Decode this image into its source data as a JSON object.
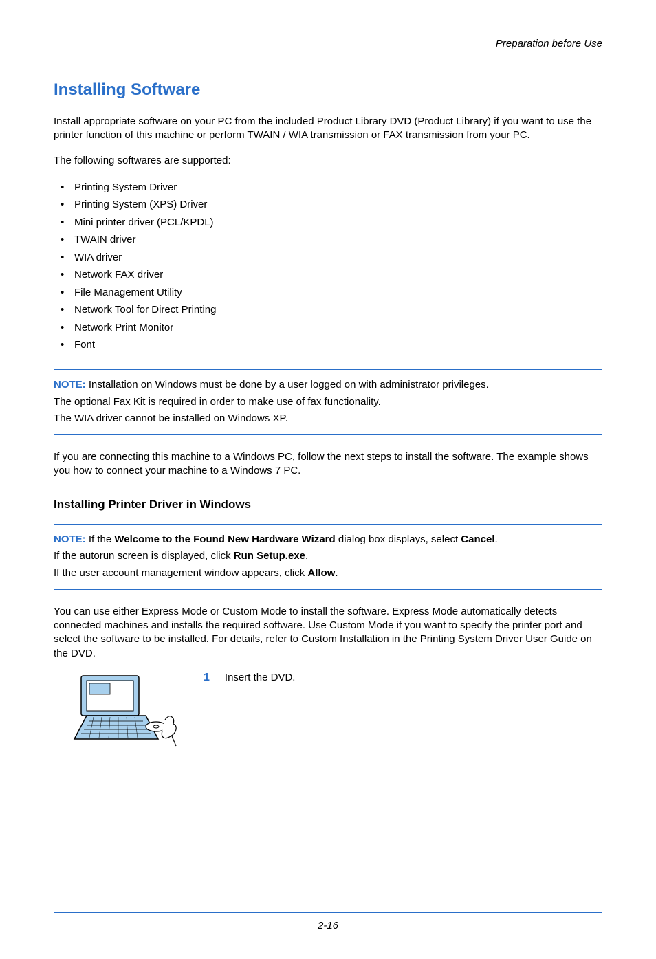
{
  "running_head": "Preparation before Use",
  "section_title": "Installing Software",
  "intro_para": "Install appropriate software on your PC from the included Product Library DVD (Product Library) if you want to use the printer function of this machine or perform TWAIN / WIA transmission or FAX transmission from your PC.",
  "supported_line": "The following softwares are supported:",
  "software_list": [
    "Printing System Driver",
    "Printing System (XPS) Driver",
    "Mini printer driver (PCL/KPDL)",
    "TWAIN driver",
    "WIA driver",
    "Network FAX driver",
    "File Management Utility",
    "Network Tool for Direct Printing",
    "Network Print Monitor",
    "Font"
  ],
  "note1": {
    "label": "NOTE:",
    "line1_rest": " Installation on Windows must be done by a user logged on with administrator privileges.",
    "line2": "The optional Fax Kit is required in order to make use of fax functionality.",
    "line3": "The WIA driver cannot be installed on Windows XP."
  },
  "connect_para": "If you are connecting this machine to a Windows PC, follow the next steps to install the software. The example shows you how to connect your machine to a Windows 7 PC.",
  "subhead": "Installing Printer Driver in Windows",
  "note2": {
    "label": "NOTE:",
    "l1_a": " If the ",
    "l1_b_bold": "Welcome to the Found New Hardware Wizard",
    "l1_c": " dialog box displays, select ",
    "l1_d_bold": "Cancel",
    "l1_e": ".",
    "l2_a": "If the autorun screen is displayed,  click ",
    "l2_b_bold": "Run Setup.exe",
    "l2_c": ".",
    "l3_a": "If the user account management window appears, click ",
    "l3_b_bold": "Allow",
    "l3_c": "."
  },
  "modes_para": "You can use either Express Mode or Custom Mode to install the software. Express Mode automatically detects connected machines and installs the required software. Use Custom Mode if you want to specify the printer port and select the software to be installed. For details, refer to Custom Installation in the Printing System Driver User Guide on the DVD.",
  "step1_num": "1",
  "step1_text": "Insert the DVD.",
  "page_number": "2-16"
}
